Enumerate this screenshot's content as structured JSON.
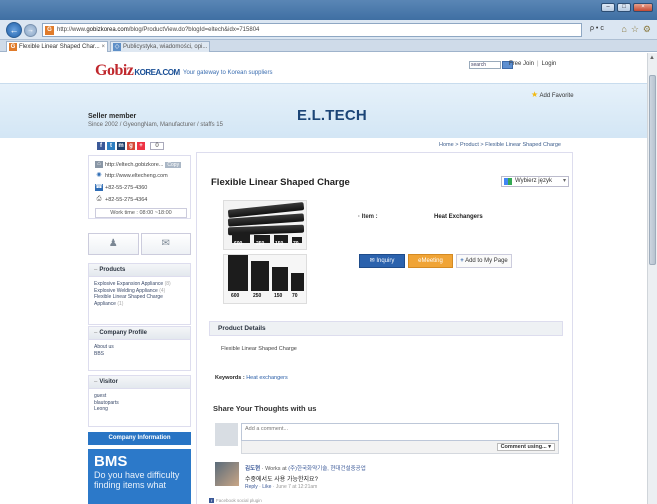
{
  "browser": {
    "url_prefix": "http://www.",
    "url_host": "gobizkorea.com",
    "url_path": "/blog/ProductView.do?blogId=eltech&idx=715804",
    "address_tools": "ρ • c",
    "tabs": [
      {
        "label": "Flexible Linear Shaped Char...",
        "close": "×"
      },
      {
        "label": "Publicystyka, wiadomości, opi..."
      }
    ],
    "window_buttons": {
      "minimize": "–",
      "maximize": "□",
      "close": "×"
    }
  },
  "site_header": {
    "logo_main": "Gobiz",
    "logo_rest": "KOREA.COM",
    "tagline": "Your gateway to Korean suppliers",
    "search_placeholder": "search",
    "links": [
      "Free Join",
      "Login"
    ]
  },
  "banner": {
    "add_favorite": "Add Favorite",
    "seller_label": "Seller member",
    "seller_info": "Since 2002 / GyeongNam, Manufacturer / staffs 15",
    "company_name": "E.L.TECH"
  },
  "sidebar": {
    "like_count": "0",
    "contacts": [
      {
        "icon": "home-icon",
        "text": "http://eltech.gobizkore...",
        "badge": "Copy"
      },
      {
        "icon": "globe-icon",
        "text": "http://www.eltecheng.com"
      },
      {
        "icon": "phone-icon",
        "text": "+82-55-275-4360"
      },
      {
        "icon": "fax-icon",
        "text": "+82-55-275-4364"
      }
    ],
    "work_time": "Work time : 08:00 ~18:00",
    "products_title": "Products",
    "products": [
      {
        "name": "Explosive Expansion Appliance",
        "count": "(8)"
      },
      {
        "name": "Explosive Welding Appliance",
        "count": "(4)"
      },
      {
        "name": "Flexible Linear Shaped Charge Appliance",
        "count": "(1)"
      }
    ],
    "profile_title": "Company Profile",
    "profile_items": [
      "About us",
      "BBS"
    ],
    "visitor_title": "Visitor",
    "visitors": [
      "guest",
      "blautoparts",
      "Leong"
    ],
    "company_info_button": "Company Information",
    "bms_title": "BMS",
    "bms_text": "Do you have difficulty finding items what"
  },
  "breadcrumb": "Home > Product > Flexible Linear Shaped Charge",
  "product": {
    "title": "Flexible Linear Shaped Charge",
    "language_select": "Wybierz język",
    "item_label": "Item :",
    "item_value": "Heat Exchangers",
    "image1_labels": [
      "600",
      "250",
      "150",
      "70"
    ],
    "image2_labels": [
      "600",
      "250",
      "150",
      "70"
    ],
    "buttons": {
      "inquiry": "Inquiry",
      "meeting": "eMeeting",
      "add_page": "Add to My Page"
    },
    "details_header": "Product Details",
    "details_text": "Flexible Linear Shaped Charge",
    "keywords_label": "Keywords :",
    "keywords_value": "Heat exchangers"
  },
  "comments": {
    "header": "Share Your Thoughts with us",
    "placeholder": "Add a comment...",
    "comment_as": "Comment using...",
    "entry": {
      "name": "김도현",
      "meta_prefix": "· Works at ",
      "meta_link": "(주)한국화약기술, 현대건설중공업",
      "text": "수중에서도 사용 가능한지요?",
      "reply": "Reply",
      "like": "Like",
      "time": "· June 7 at 12:21am"
    },
    "plugin_label": "Facebook social plugin"
  }
}
